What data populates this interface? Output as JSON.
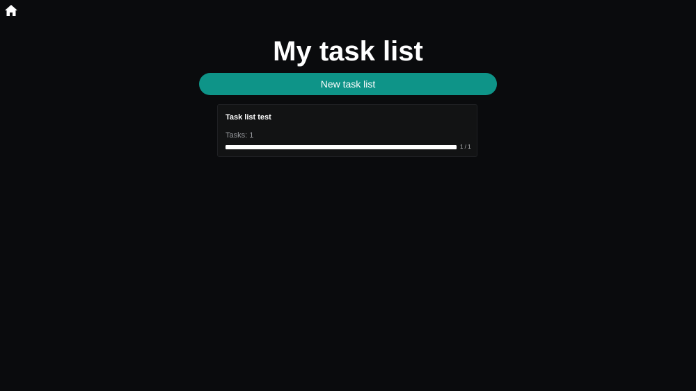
{
  "nav": {
    "home_icon": "home-icon"
  },
  "header": {
    "title": "My task list"
  },
  "actions": {
    "new_list_label": "New task list"
  },
  "colors": {
    "accent": "#0e9488",
    "background": "#0a0b0d",
    "card": "#121314"
  },
  "task_lists": [
    {
      "title": "Task list test",
      "tasks_label": "Tasks: 1",
      "progress_text": "1 / 1",
      "progress_fraction": 1.0
    }
  ]
}
